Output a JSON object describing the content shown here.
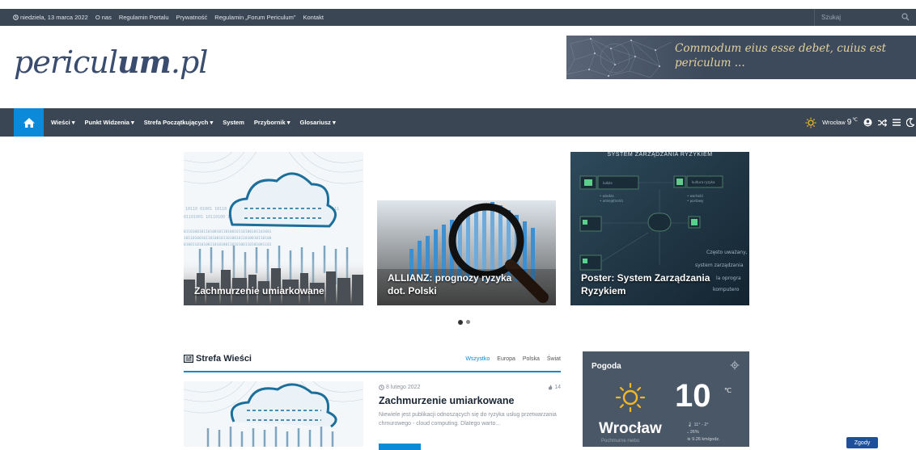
{
  "topbar": {
    "date": "niedziela, 13 marca 2022",
    "links": [
      "O nas",
      "Regulamin Portalu",
      "Prywatność",
      "Regulamin „Forum Periculum\"",
      "Kontakt"
    ],
    "search_placeholder": "Szukaj"
  },
  "header": {
    "logo_prefix": "pericul",
    "logo_bold": "um",
    "logo_suffix": ".pl",
    "banner_quote": "Commodum eius esse debet, cuius est periculum ..."
  },
  "nav": {
    "items": [
      "Wieści ▾",
      "Punkt Widzenia ▾",
      "Strefa Początkujących ▾",
      "System",
      "Przybornik ▾",
      "Glosariusz ▾"
    ],
    "weather_city": "Wrocław",
    "weather_temp": "9",
    "weather_unit": "℃"
  },
  "slider": {
    "slides": [
      {
        "title": "Zachmurzenie umiarkowane"
      },
      {
        "title": "ALLIANZ: prognozy ryzyka dot. Polski"
      },
      {
        "title": "Poster: System Zarządzania Ryzykiem"
      }
    ],
    "poster_header": "SYSTEM ZARZĄDZANIA RYZYKIEM"
  },
  "section": {
    "title": "Strefa Wieści",
    "filters": [
      "Wszystko",
      "Europa",
      "Polska",
      "Świat"
    ]
  },
  "post": {
    "date": "8 lutego 2022",
    "views": "14",
    "title": "Zachmurzenie umiarkowane",
    "excerpt": "Niewiele jest publikacji odnoszących się do ryzyka usług przetwarzania chmurowego - cloud computing. Dlatego warto..."
  },
  "weather": {
    "title": "Pogoda",
    "temp": "10",
    "unit": "℃",
    "city": "Wrocław",
    "description": "Pochmurne niebo",
    "minmax": "11° - 2°",
    "humidity": "26%",
    "wind": "9.26 km/godz."
  },
  "consent_button": "Zgody",
  "colors": {
    "accent": "#0a8ad8",
    "dark": "#3a4654",
    "logo": "#3a4d6f",
    "quote": "#e5d29a"
  }
}
